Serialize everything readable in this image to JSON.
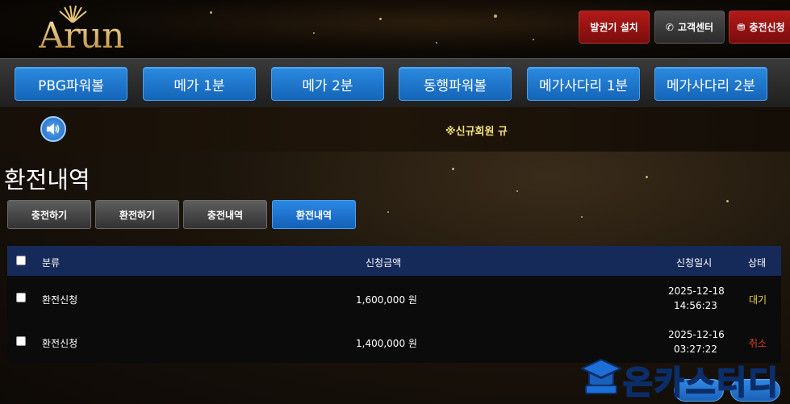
{
  "header": {
    "logo_text": "Arun",
    "buttons": [
      {
        "label": "발권기 설치",
        "icon": ""
      },
      {
        "label": "고객센터",
        "icon": "phone-icon"
      },
      {
        "label": "충전신청",
        "icon": "coins-icon"
      }
    ]
  },
  "nav": {
    "items": [
      "PBG파워볼",
      "메가 1분",
      "메가 2분",
      "동행파워볼",
      "메가사다리 1분",
      "메가사다리 2분"
    ]
  },
  "notice": {
    "text": "※신규회원 규",
    "icon": "speaker-icon"
  },
  "page": {
    "title": "환전내역",
    "tabs": [
      {
        "label": "충전하기",
        "active": false
      },
      {
        "label": "환전하기",
        "active": false
      },
      {
        "label": "충전내역",
        "active": false
      },
      {
        "label": "환전내역",
        "active": true
      }
    ]
  },
  "table": {
    "headers": {
      "category": "분류",
      "amount": "신청금액",
      "date": "신청일시",
      "status": "상태"
    },
    "rows": [
      {
        "category": "환전신청",
        "amount": "1,600,000 원",
        "date": "2025-12-18",
        "time": "14:56:23",
        "status": "대기",
        "status_color": "#f2d74a"
      },
      {
        "category": "환전신청",
        "amount": "1,400,000 원",
        "date": "2025-12-16",
        "time": "03:27:22",
        "status": "취소",
        "status_color": "#e53a2a"
      }
    ]
  },
  "watermark": {
    "text": "온카스터디"
  },
  "colors": {
    "nav_blue": "#1e76cf",
    "header_red": "#9c1412",
    "table_header": "#162a5a"
  }
}
